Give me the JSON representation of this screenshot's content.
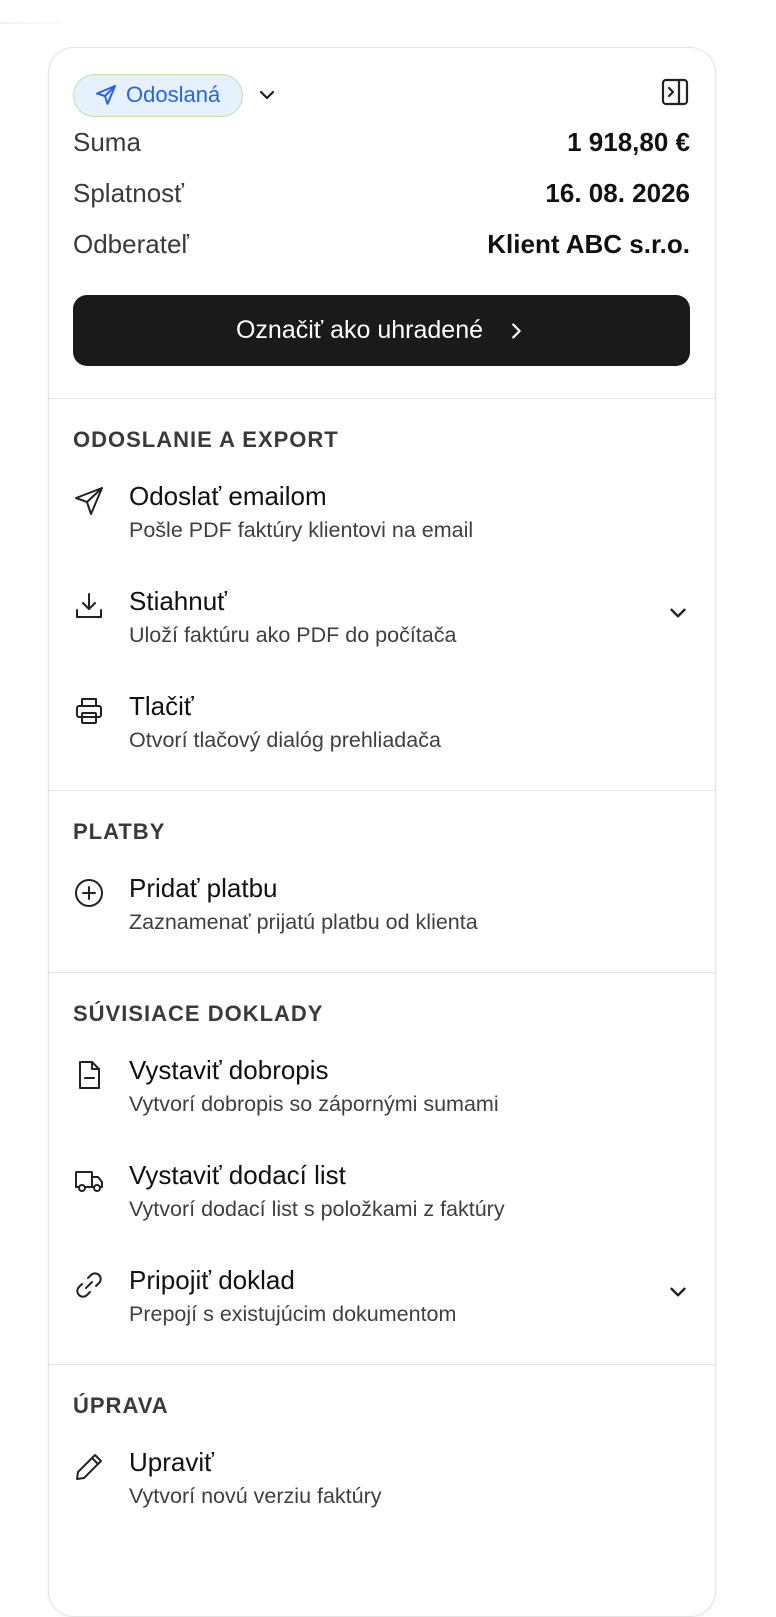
{
  "status": {
    "label": "Odoslaná",
    "icon": "send-icon"
  },
  "summary": [
    {
      "label": "Suma",
      "value": "1 918,80 €"
    },
    {
      "label": "Splatnosť",
      "value": "16. 08. 2026"
    },
    {
      "label": "Odberateľ",
      "value": "Klient ABC s.r.o."
    }
  ],
  "primary_action": {
    "label": "Označiť ako uhradené"
  },
  "sections": [
    {
      "title": "ODOSLANIE A EXPORT",
      "items": [
        {
          "title": "Odoslať emailom",
          "desc": "Pošle PDF faktúry klientovi na email",
          "icon": "send-icon"
        },
        {
          "title": "Stiahnuť",
          "desc": "Uloží faktúru ako PDF do počítača",
          "icon": "download-icon",
          "expandable": true
        },
        {
          "title": "Tlačiť",
          "desc": "Otvorí tlačový dialóg prehliadača",
          "icon": "printer-icon"
        }
      ]
    },
    {
      "title": "PLATBY",
      "items": [
        {
          "title": "Pridať platbu",
          "desc": "Zaznamenať prijatú platbu od klienta",
          "icon": "plus-circle-icon"
        }
      ]
    },
    {
      "title": "SÚVISIACE DOKLADY",
      "items": [
        {
          "title": "Vystaviť dobropis",
          "desc": "Vytvorí dobropis so zápornými sumami",
          "icon": "document-minus-icon"
        },
        {
          "title": "Vystaviť dodací list",
          "desc": "Vytvorí dodací list s položkami z faktúry",
          "icon": "truck-icon"
        },
        {
          "title": "Pripojiť doklad",
          "desc": "Prepojí s existujúcim dokumentom",
          "icon": "link-icon",
          "expandable": true
        }
      ]
    },
    {
      "title": "ÚPRAVA",
      "items": [
        {
          "title": "Upraviť",
          "desc": "Vytvorí novú verziu faktúry",
          "icon": "pencil-icon"
        }
      ]
    }
  ]
}
